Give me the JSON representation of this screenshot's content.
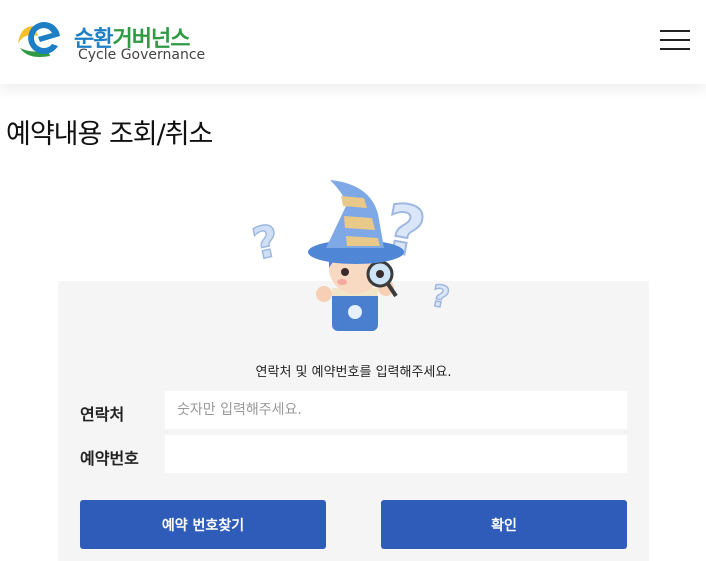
{
  "header": {
    "logo_ko_a": "순환",
    "logo_ko_b": "거버넌스",
    "logo_en": "Cycle Governance",
    "menu_icon": "hamburger-menu-icon"
  },
  "page": {
    "title": "예약내용 조회/취소"
  },
  "form": {
    "instruction": "연락처 및 예약번호를 입력해주세요.",
    "contact_label": "연락처",
    "contact_placeholder": "숫자만 입력해주세요.",
    "contact_value": "",
    "reservation_label": "예약번호",
    "reservation_placeholder": "",
    "reservation_value": "",
    "find_button": "예약 번호찾기",
    "confirm_button": "확인"
  },
  "colors": {
    "primary_button": "#2f5cb8",
    "logo_blue": "#1e7fc4",
    "logo_green": "#2f9a44",
    "panel_bg": "#f5f5f5"
  }
}
